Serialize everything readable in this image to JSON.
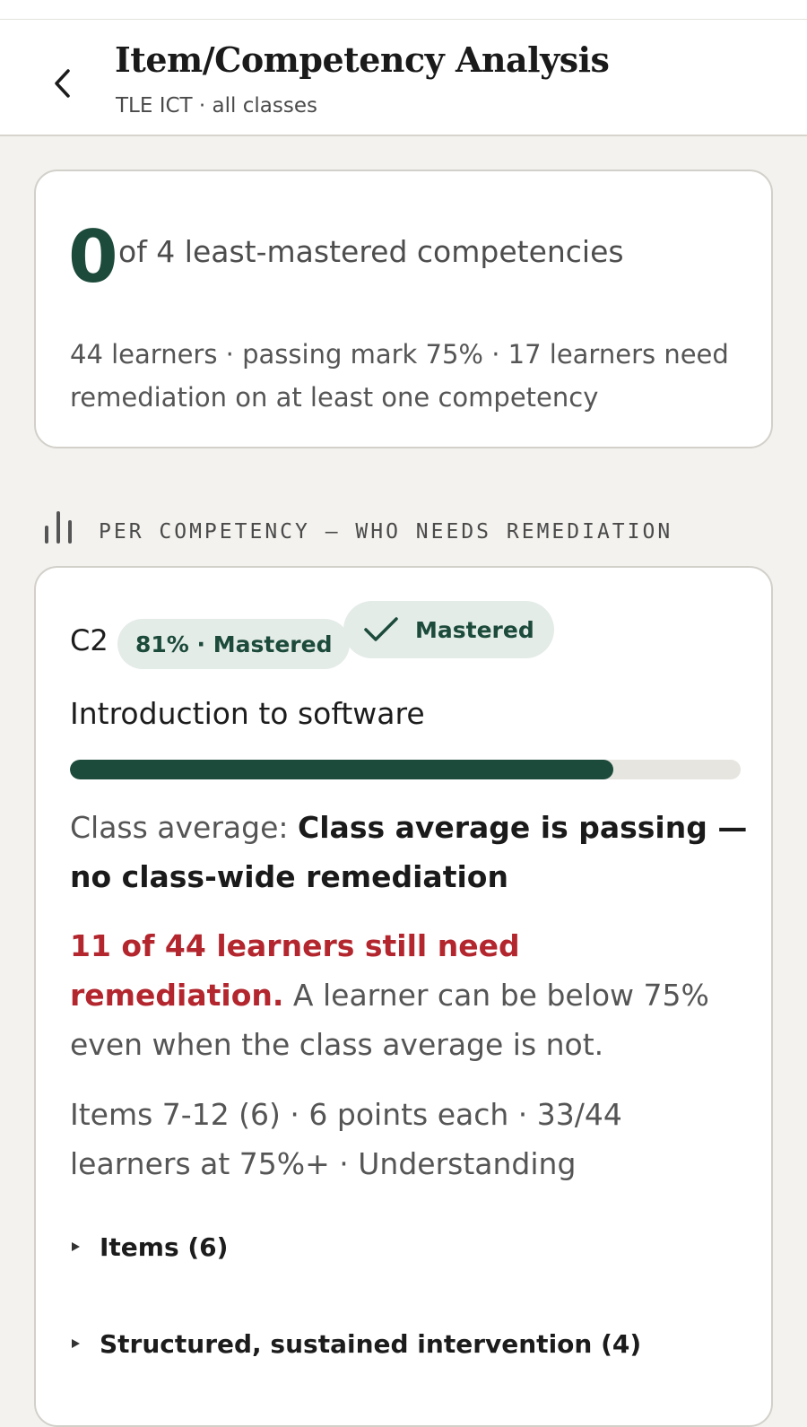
{
  "header": {
    "title": "Item/Competency Analysis",
    "subtitle": "TLE ICT · all classes"
  },
  "summary": {
    "count": "0",
    "count_text": "of 4 least-mastered competencies",
    "detail": "44 learners · passing mark 75% · 17 learners need remediation on at least one competency"
  },
  "section": {
    "label": "PER COMPETENCY — WHO NEEDS REMEDIATION"
  },
  "competency": {
    "code": "C2",
    "percent_badge": "81% · Mastered",
    "status_badge": "Mastered",
    "name": "Introduction to software",
    "progress_percent": 81,
    "average_label": "Class average:",
    "average_value": "Class average is passing — no class-wide remediation",
    "remediation_highlight": "11 of 44 learners still need remediation.",
    "remediation_note": " A learner can be below 75% even when the class average is not.",
    "items_info": "Items 7-12 (6) · 6 points each · 33/44 learners at 75%+ · Understanding",
    "disclosures": [
      {
        "label": "Items (6)"
      },
      {
        "label": "Structured, sustained intervention (4)"
      }
    ]
  },
  "colors": {
    "accent": "#1c4a3b",
    "alert": "#b3262e",
    "pill_bg": "#e4ece8"
  }
}
